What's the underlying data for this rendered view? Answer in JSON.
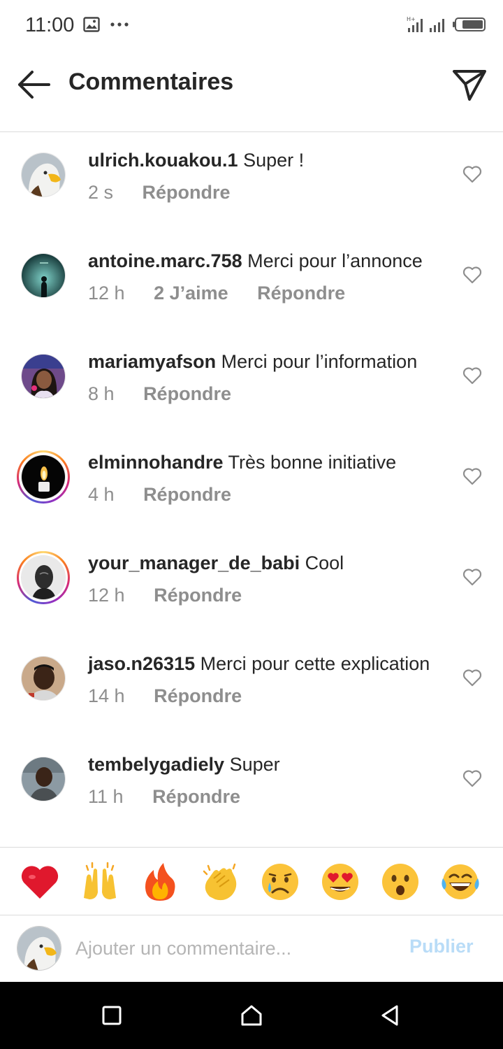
{
  "status_bar": {
    "time": "11:00",
    "icons": [
      "gallery-icon",
      "more-dots-icon",
      "signal-icon",
      "battery-icon"
    ]
  },
  "header": {
    "title": "Commentaires",
    "back_icon": "arrow-left-icon",
    "send_icon": "paper-plane-icon"
  },
  "comments": [
    {
      "username": "ulrich.kouakou.1",
      "text": "Super !",
      "time": "2 s",
      "likes": "",
      "reply_label": "Répondre",
      "avatar": "eagle",
      "story_ring": false
    },
    {
      "username": "antoine.marc.758",
      "text": "Merci pour l’annonce",
      "time": "12 h",
      "likes": "2 J’aime",
      "reply_label": "Répondre",
      "avatar": "teal-silhouette",
      "story_ring": false
    },
    {
      "username": "mariamyafson",
      "text": "Merci pour l’information",
      "time": "8 h",
      "likes": "",
      "reply_label": "Répondre",
      "avatar": "woman-portrait",
      "story_ring": false
    },
    {
      "username": "elminnohandre",
      "text": "Très bonne initiative",
      "time": "4 h",
      "likes": "",
      "reply_label": "Répondre",
      "avatar": "candle",
      "story_ring": true
    },
    {
      "username": "your_manager_de_babi",
      "text": "Cool",
      "time": "12 h",
      "likes": "",
      "reply_label": "Répondre",
      "avatar": "statue-head",
      "story_ring": true
    },
    {
      "username": "jaso.n26315",
      "text": "Merci pour cette explication",
      "time": "14 h",
      "likes": "",
      "reply_label": "Répondre",
      "avatar": "boy-portrait",
      "story_ring": false
    },
    {
      "username": "tembelygadiely",
      "text": "Super",
      "time": "11 h",
      "likes": "",
      "reply_label": "Répondre",
      "avatar": "man-outdoor",
      "story_ring": false
    }
  ],
  "emoji_bar": [
    "❤️",
    "🙌",
    "🔥",
    "👏",
    "😢",
    "😍",
    "😮",
    "😂"
  ],
  "composer": {
    "placeholder": "Ajouter un commentaire...",
    "publish_label": "Publier"
  },
  "nav_bar": [
    "recents-square-icon",
    "home-icon",
    "back-triangle-icon"
  ]
}
